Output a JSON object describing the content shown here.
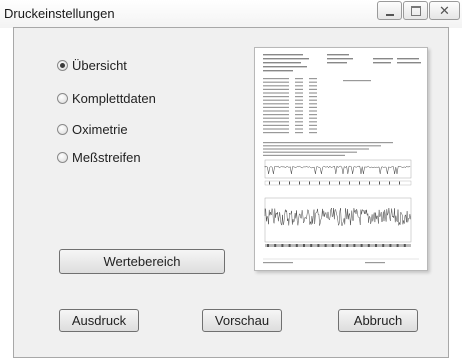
{
  "window": {
    "title": "Druckeinstellungen",
    "controls": [
      "minimize-icon",
      "maximize-icon",
      "close-icon"
    ],
    "close_glyph": "✕"
  },
  "options": {
    "selected": 0,
    "items": [
      {
        "label": "Übersicht",
        "checked": true
      },
      {
        "label": "Komplettdaten",
        "checked": false
      },
      {
        "label": "Oximetrie",
        "checked": false
      },
      {
        "label": "Meßstreifen",
        "checked": false
      }
    ]
  },
  "buttons": {
    "range": "Wertebereich",
    "print": "Ausdruck",
    "preview": "Vorschau",
    "cancel": "Abbruch"
  },
  "colors": {
    "client_background": "#f0f0f0",
    "button_border": "#707070",
    "preview_border": "#b8b8b8"
  }
}
